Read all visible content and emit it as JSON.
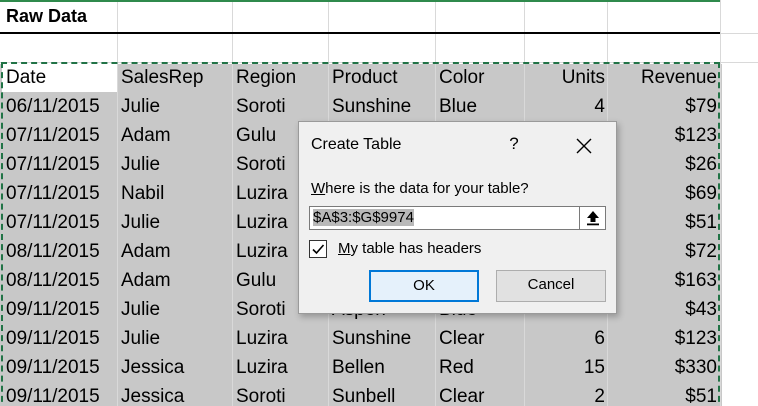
{
  "sheet": {
    "title": "Raw Data",
    "headers": [
      "Date",
      "SalesRep",
      "Region",
      "Product",
      "Color",
      "Units",
      "Revenue"
    ],
    "rows": [
      [
        "06/11/2015",
        "Julie",
        "Soroti",
        "Sunshine",
        "Blue",
        "4",
        "$79"
      ],
      [
        "07/11/2015",
        "Adam",
        "Gulu",
        "",
        "",
        "",
        "$123"
      ],
      [
        "07/11/2015",
        "Julie",
        "Soroti",
        "",
        "",
        "",
        "$26"
      ],
      [
        "07/11/2015",
        "Nabil",
        "Luzira",
        "",
        "",
        "",
        "$69"
      ],
      [
        "07/11/2015",
        "Julie",
        "Luzira",
        "",
        "",
        "",
        "$51"
      ],
      [
        "08/11/2015",
        "Adam",
        "Luzira",
        "",
        "",
        "",
        "$72"
      ],
      [
        "08/11/2015",
        "Adam",
        "Gulu",
        "",
        "",
        "",
        "$163"
      ],
      [
        "09/11/2015",
        "Julie",
        "Soroti",
        "Aspen",
        "Blue",
        "",
        "$43"
      ],
      [
        "09/11/2015",
        "Julie",
        "Luzira",
        "Sunshine",
        "Clear",
        "6",
        "$123"
      ],
      [
        "09/11/2015",
        "Jessica",
        "Luzira",
        "Bellen",
        "Red",
        "15",
        "$330"
      ],
      [
        "09/11/2015",
        "Jessica",
        "Soroti",
        "Sunbell",
        "Clear",
        "2",
        "$51"
      ]
    ]
  },
  "dialog": {
    "title": "Create Table",
    "help": "?",
    "prompt_underlined": "W",
    "prompt_rest": "here is the data for your table?",
    "range_value": "$A$3:$G$9974",
    "checkbox_underlined": "M",
    "checkbox_rest": "y table has headers",
    "ok_label": "OK",
    "cancel_label": "Cancel"
  },
  "colors": {
    "selection_border": "#217346",
    "selection_fill": "#c8c8c8",
    "ok_border": "#0078d7"
  },
  "icons": {
    "close": "close-icon",
    "collapse": "collapse-dialog-icon",
    "check": "checkmark-icon"
  }
}
